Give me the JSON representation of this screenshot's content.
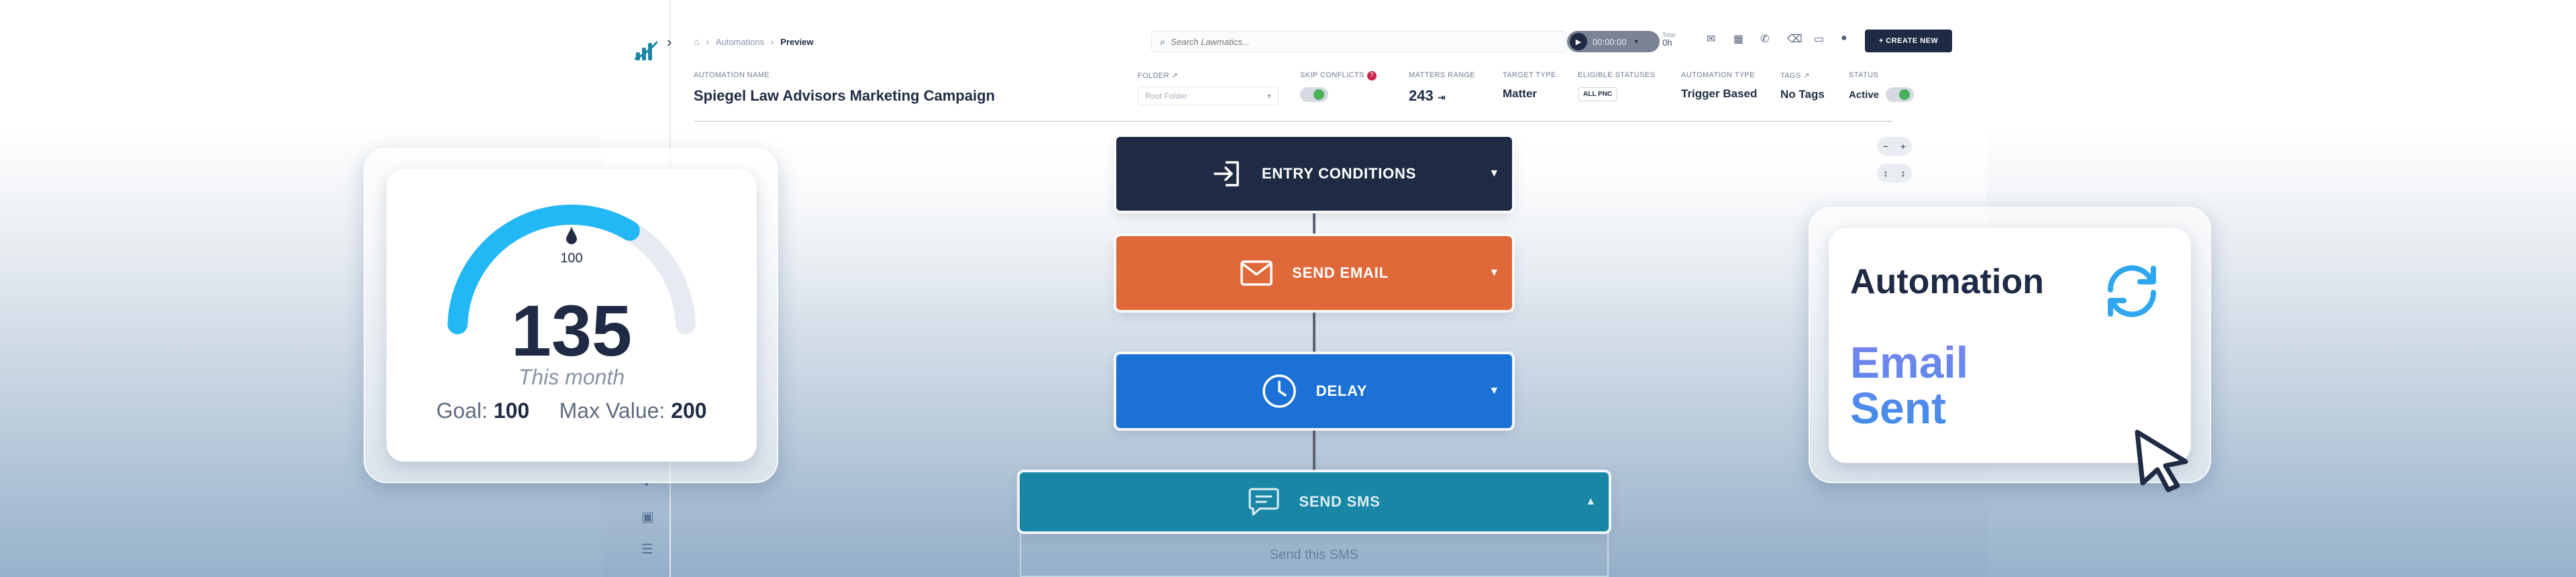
{
  "header": {
    "breadcrumb": [
      "Automations",
      "Preview"
    ],
    "search_placeholder": "Search Lawmatics...",
    "timer": "00:00:00",
    "total_label": "Total",
    "total_value": "0h",
    "create_label": "+ CREATE NEW"
  },
  "automation": {
    "name_label": "AUTOMATION NAME",
    "name": "Spiegel Law Advisors Marketing Campaign",
    "folder_label": "FOLDER",
    "folder_value": "Root Folder",
    "skip_conflicts_label": "SKIP CONFLICTS",
    "matters_range_label": "MATTERS RANGE",
    "matters_range_value": "243",
    "target_type_label": "TARGET TYPE",
    "target_type_value": "Matter",
    "eligible_statuses_label": "ELIGIBLE STATUSES",
    "eligible_statuses_value": "ALL PNC",
    "automation_type_label": "AUTOMATION TYPE",
    "automation_type_value": "Trigger Based",
    "tags_label": "TAGS",
    "tags_value": "No Tags",
    "status_label": "STATUS",
    "status_value": "Active"
  },
  "flow": {
    "entry": "ENTRY CONDITIONS",
    "email": "SEND EMAIL",
    "delay": "DELAY",
    "sms": "SEND SMS",
    "sms_body": "Send this SMS",
    "colors": {
      "entry": "#1f2b44",
      "email": "#e0693a",
      "delay": "#1b71d6",
      "sms": "#1a86a6"
    }
  },
  "gauge_card": {
    "value": "135",
    "subtitle": "This month",
    "marker_label": "100",
    "goal_label": "Goal:",
    "goal_value": "100",
    "max_label": "Max Value:",
    "max_value": "200",
    "progress": 0.675,
    "marker_fraction": 0.5,
    "fill_color": "#22b7f5",
    "track_color": "#e7ebf1"
  },
  "automation_card": {
    "title": "Automation",
    "status_line1": "Email",
    "status_line2": "Sent"
  }
}
